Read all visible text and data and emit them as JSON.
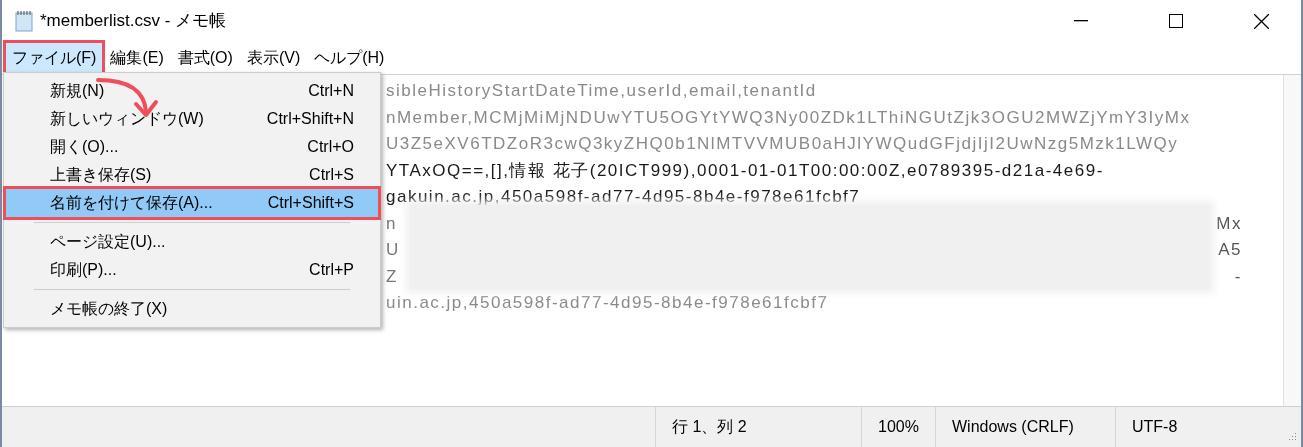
{
  "window": {
    "title": "*memberlist.csv - メモ帳"
  },
  "menu_bar": [
    {
      "label": "ファイル(F)",
      "selected": true,
      "highlighted": true
    },
    {
      "label": "編集(E)",
      "selected": false,
      "highlighted": false
    },
    {
      "label": "書式(O)",
      "selected": false,
      "highlighted": false
    },
    {
      "label": "表示(V)",
      "selected": false,
      "highlighted": false
    },
    {
      "label": "ヘルプ(H)",
      "selected": false,
      "highlighted": false
    }
  ],
  "file_menu": [
    {
      "kind": "item",
      "label": "新規(N)",
      "shortcut": "Ctrl+N",
      "selected": false,
      "highlighted": false
    },
    {
      "kind": "item",
      "label": "新しいウィンドウ(W)",
      "shortcut": "Ctrl+Shift+N",
      "selected": false,
      "highlighted": false
    },
    {
      "kind": "item",
      "label": "開く(O)...",
      "shortcut": "Ctrl+O",
      "selected": false,
      "highlighted": false
    },
    {
      "kind": "item",
      "label": "上書き保存(S)",
      "shortcut": "Ctrl+S",
      "selected": false,
      "highlighted": false
    },
    {
      "kind": "item",
      "label": "名前を付けて保存(A)...",
      "shortcut": "Ctrl+Shift+S",
      "selected": true,
      "highlighted": true
    },
    {
      "kind": "separator"
    },
    {
      "kind": "item",
      "label": "ページ設定(U)...",
      "selected": false,
      "highlighted": false
    },
    {
      "kind": "item",
      "label": "印刷(P)...",
      "shortcut": "Ctrl+P",
      "selected": false,
      "highlighted": false
    },
    {
      "kind": "separator"
    },
    {
      "kind": "item",
      "label": "メモ帳の終了(X)",
      "selected": false,
      "highlighted": false
    }
  ],
  "editor_lines": [
    {
      "kind": "text",
      "text": "sibleHistoryStartDateTime,userId,email,tenantId",
      "faded": true
    },
    {
      "kind": "text",
      "text": "nMember,MCMjMiMjNDUwYTU5OGYtYWQ3Ny00ZDk1LThiNGUtZjk3OGU2MWZjYmY3IyMx",
      "faded": true
    },
    {
      "kind": "text",
      "text": "U3Z5eXV6TDZoR3cwQ3kyZHQ0b1NlMTVVMUB0aHJlYWQudGFjdjIjI2UwNzg5Mzk1LWQy",
      "faded": true
    },
    {
      "kind": "text",
      "text": "YTAxOQ==,[],情報 花子(20ICT999),0001-01-01T00:00:00Z,e0789395-d21a-4e69-",
      "faded": false
    },
    {
      "kind": "text",
      "text": "gakuin.ac.jp,450a598f-ad77-4d95-8b4e-f978e61fcbf7",
      "faded": false
    },
    {
      "kind": "redacted",
      "left": "n",
      "right": "Mx"
    },
    {
      "kind": "redacted",
      "left": "U",
      "right": "A5"
    },
    {
      "kind": "redacted",
      "left": "Z",
      "right": "-"
    },
    {
      "kind": "text",
      "text": "uin.ac.jp,450a598f-ad77-4d95-8b4e-f978e61fcbf7",
      "faded": true
    }
  ],
  "status_bar": [
    "行 1、列 2",
    "100%",
    "Windows (CRLF)",
    "UTF-8"
  ]
}
